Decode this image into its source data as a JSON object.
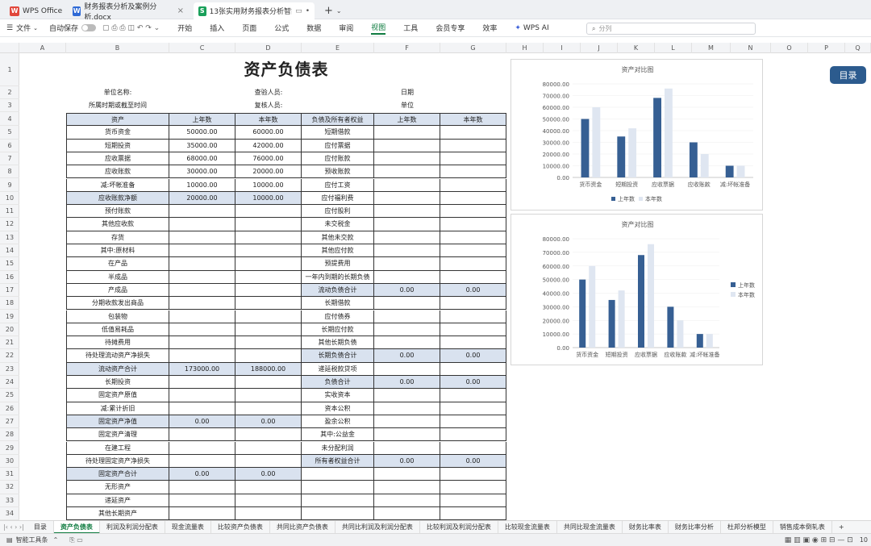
{
  "window": {
    "tabs": [
      {
        "label": "WPS Office",
        "icon": "wps-logo-icon",
        "color": "#e1473b"
      },
      {
        "label": "财务报表分析及案例分析.docx",
        "icon": "word-doc-icon",
        "color": "#2f6ad6"
      },
      {
        "label": "13张实用财务报表分析智能匹...",
        "icon": "sheet-doc-icon",
        "color": "#19a05a"
      }
    ],
    "new_tab": "+"
  },
  "menu": {
    "file": "文件",
    "autosave": "自动保存",
    "items": [
      "开始",
      "插入",
      "页面",
      "公式",
      "数据",
      "审阅",
      "视图",
      "工具",
      "会员专享",
      "效率"
    ],
    "active": "视图",
    "ai": "WPS AI",
    "search_placeholder": "分列"
  },
  "columns": [
    "A",
    "B",
    "C",
    "D",
    "E",
    "F",
    "G",
    "H",
    "I",
    "J",
    "K",
    "L",
    "M",
    "N",
    "O",
    "P",
    "Q"
  ],
  "rows": [
    "1",
    "2",
    "3",
    "4",
    "5",
    "6",
    "7",
    "8",
    "9",
    "10",
    "11",
    "12",
    "13",
    "14",
    "15",
    "16",
    "17",
    "18",
    "19",
    "20",
    "21",
    "22",
    "23",
    "24",
    "25",
    "26",
    "27",
    "28",
    "29",
    "30",
    "31",
    "32",
    "33",
    "34"
  ],
  "sheet": {
    "title": "资产负债表",
    "info": {
      "unit_name": "单位名称:",
      "period": "所属时期或截至时间",
      "checker": "查验人员:",
      "reviewer": "复核人员:",
      "date": "日期",
      "unit": "单位"
    },
    "headers": [
      "资产",
      "上年数",
      "本年数",
      "负债及所有者权益",
      "上年数",
      "本年数"
    ],
    "rows": [
      [
        "货币资金",
        "50000.00",
        "60000.00",
        "短期借款",
        "",
        ""
      ],
      [
        "短期投资",
        "35000.00",
        "42000.00",
        "应付票据",
        "",
        ""
      ],
      [
        "应收票据",
        "68000.00",
        "76000.00",
        "应付账款",
        "",
        ""
      ],
      [
        "应收账款",
        "30000.00",
        "20000.00",
        "预收账款",
        "",
        ""
      ],
      [
        "减:坏帐准备",
        "10000.00",
        "10000.00",
        "应付工资",
        "",
        ""
      ],
      [
        "应收账款净额",
        "20000.00",
        "10000.00",
        "应付福利费",
        "",
        ""
      ],
      [
        "预付账款",
        "",
        "",
        "应付股利",
        "",
        ""
      ],
      [
        "其他应收款",
        "",
        "",
        "未交税金",
        "",
        ""
      ],
      [
        "存货",
        "",
        "",
        "其他未交款",
        "",
        ""
      ],
      [
        "其中:原材料",
        "",
        "",
        "其他应付款",
        "",
        ""
      ],
      [
        "在产品",
        "",
        "",
        "预提费用",
        "",
        ""
      ],
      [
        "半成品",
        "",
        "",
        "一年内到期的长期负债",
        "",
        ""
      ],
      [
        "产成品",
        "",
        "",
        "流动负债合计",
        "0.00",
        "0.00"
      ],
      [
        "分期收款发出商品",
        "",
        "",
        "长期借款",
        "",
        ""
      ],
      [
        "包装物",
        "",
        "",
        "应付债券",
        "",
        ""
      ],
      [
        "低值易耗品",
        "",
        "",
        "长期应付款",
        "",
        ""
      ],
      [
        "待摊费用",
        "",
        "",
        "其他长期负债",
        "",
        ""
      ],
      [
        "待处理流动资产净损失",
        "",
        "",
        "长期负债合计",
        "0.00",
        "0.00"
      ],
      [
        "流动资产合计",
        "173000.00",
        "188000.00",
        "递延税款贷项",
        "",
        ""
      ],
      [
        "长期投资",
        "",
        "",
        "负债合计",
        "0.00",
        "0.00"
      ],
      [
        "固定资产原值",
        "",
        "",
        "实收资本",
        "",
        ""
      ],
      [
        "减:累计折旧",
        "",
        "",
        "资本公积",
        "",
        ""
      ],
      [
        "固定资产净值",
        "0.00",
        "0.00",
        "盈余公积",
        "",
        ""
      ],
      [
        "固定资产清理",
        "",
        "",
        "其中:公益金",
        "",
        ""
      ],
      [
        "在建工程",
        "",
        "",
        "未分配利润",
        "",
        ""
      ],
      [
        "待处理固定资产净损失",
        "",
        "",
        "所有者权益合计",
        "0.00",
        "0.00"
      ],
      [
        "固定资产合计",
        "0.00",
        "0.00",
        "",
        "",
        ""
      ],
      [
        "无形资产",
        "",
        "",
        "",
        "",
        ""
      ],
      [
        "递延资产",
        "",
        "",
        "",
        "",
        ""
      ],
      [
        "其他长期资产",
        "",
        "",
        "",
        "",
        ""
      ]
    ]
  },
  "catalog_button": "目录",
  "chart_data": [
    {
      "type": "bar",
      "title": "资产对比图",
      "categories": [
        "货币资金",
        "短期投资",
        "应收票据",
        "应收账款",
        "减:坏帐准备"
      ],
      "series": [
        {
          "name": "上年数",
          "values": [
            50000,
            35000,
            68000,
            30000,
            10000
          ],
          "color": "#365f93"
        },
        {
          "name": "本年数",
          "values": [
            60000,
            42000,
            76000,
            20000,
            10000
          ],
          "color": "#dfe6f1"
        }
      ],
      "y_ticks": [
        "0.00",
        "10000.00",
        "20000.00",
        "30000.00",
        "40000.00",
        "50000.00",
        "60000.00",
        "70000.00",
        "80000.00"
      ],
      "ylim": [
        0,
        80000
      ],
      "legend": "bottom"
    },
    {
      "type": "bar",
      "title": "资产对比图",
      "categories": [
        "货币资金",
        "短期投资",
        "应收票据",
        "应收账款",
        "减:坏帐准备"
      ],
      "series": [
        {
          "name": "上年数",
          "values": [
            50000,
            35000,
            68000,
            30000,
            10000
          ],
          "color": "#365f93"
        },
        {
          "name": "本年数",
          "values": [
            60000,
            42000,
            76000,
            20000,
            10000
          ],
          "color": "#dfe6f1"
        }
      ],
      "y_ticks": [
        "0.00",
        "10000.00",
        "20000.00",
        "30000.00",
        "40000.00",
        "50000.00",
        "60000.00",
        "70000.00",
        "80000.00"
      ],
      "ylim": [
        0,
        80000
      ],
      "legend": "right"
    }
  ],
  "sheet_tabs": [
    "目录",
    "资产负债表",
    "利润及利润分配表",
    "现金流量表",
    "比较资产负债表",
    "共同比资产负债表",
    "共同比利润及利润分配表",
    "比较利润及利润分配表",
    "比较现金流量表",
    "共同比现金流量表",
    "财务比率表",
    "财务比率分析",
    "杜邦分析模型",
    "销售成本倒轧表"
  ],
  "active_sheet": "资产负债表",
  "status": {
    "left": "智能工具条",
    "zoom": "10"
  }
}
